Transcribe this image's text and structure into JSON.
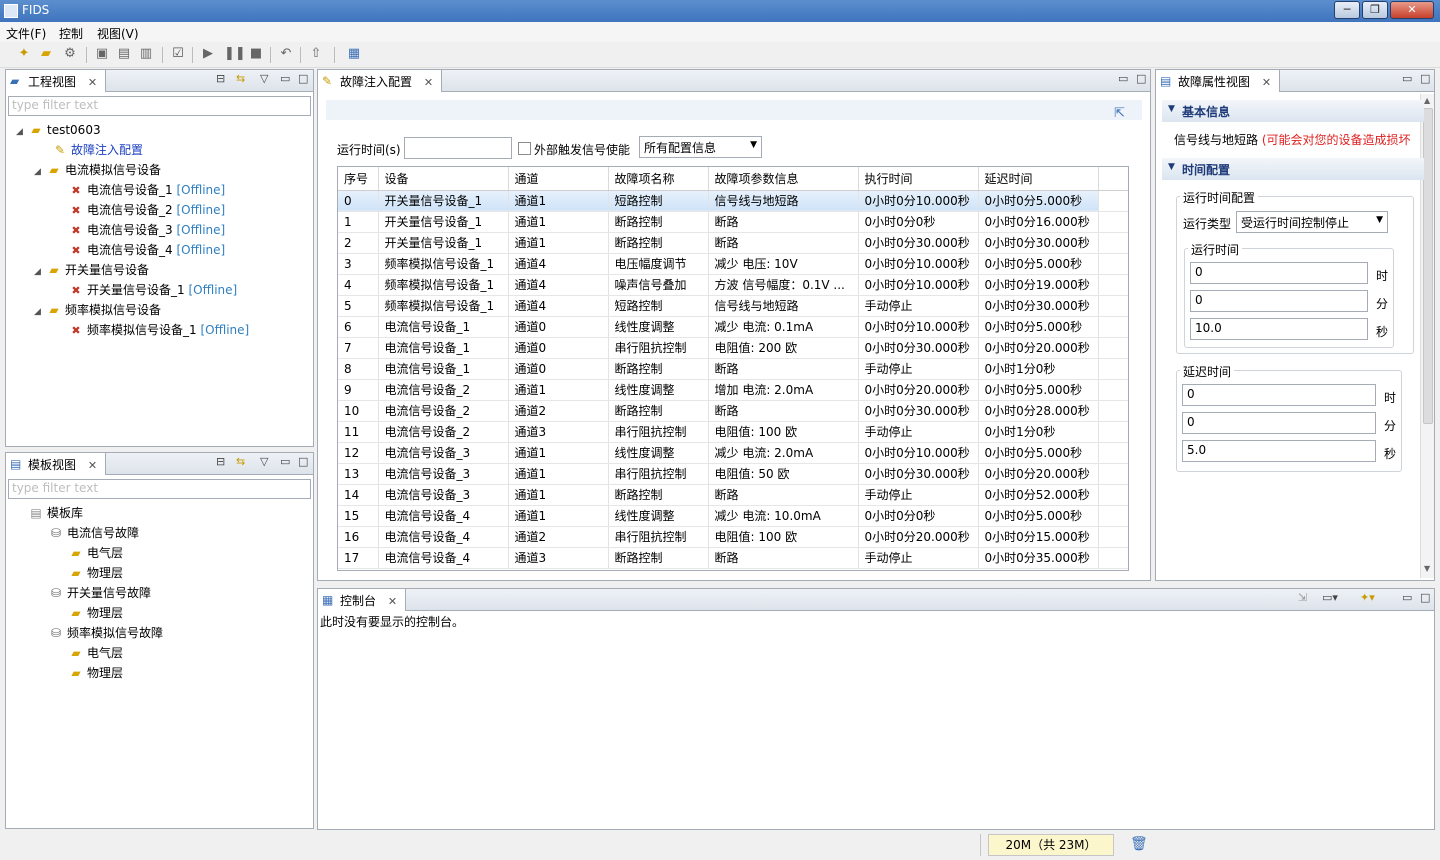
{
  "window": {
    "title": "FIDS",
    "controls": [
      "─",
      "❐",
      "✕"
    ]
  },
  "menu": {
    "items": [
      "文件(F)",
      "控制",
      "视图(V)"
    ]
  },
  "project_view": {
    "tab_label": "工程视图",
    "filter_placeholder": "type filter text",
    "root": "test0603",
    "fault_config": "故障注入配置",
    "groups": [
      {
        "label": "电流模拟信号设备",
        "devices": [
          {
            "name": "电流信号设备_1",
            "status": "[Offline]"
          },
          {
            "name": "电流信号设备_2",
            "status": "[Offline]"
          },
          {
            "name": "电流信号设备_3",
            "status": "[Offline]"
          },
          {
            "name": "电流信号设备_4",
            "status": "[Offline]"
          }
        ]
      },
      {
        "label": "开关量信号设备",
        "devices": [
          {
            "name": "开关量信号设备_1",
            "status": "[Offline]"
          }
        ]
      },
      {
        "label": "频率模拟信号设备",
        "devices": [
          {
            "name": "频率模拟信号设备_1",
            "status": "[Offline]"
          }
        ]
      }
    ]
  },
  "template_view": {
    "tab_label": "模板视图",
    "filter_placeholder": "type filter text",
    "root": "模板库",
    "groups": [
      {
        "label": "电流信号故障",
        "layers": [
          "电气层",
          "物理层"
        ]
      },
      {
        "label": "开关量信号故障",
        "layers": [
          "物理层"
        ]
      },
      {
        "label": "频率模拟信号故障",
        "layers": [
          "电气层",
          "物理层"
        ]
      }
    ]
  },
  "fault_config": {
    "tab_label": "故障注入配置",
    "run_time_label": "运行时间(s)",
    "run_time_value": "",
    "external_trigger_label": "外部触发信号使能",
    "external_trigger_checked": false,
    "filter_select": "所有配置信息",
    "columns": [
      "序号",
      "设备",
      "通道",
      "故障项名称",
      "故障项参数信息",
      "执行时间",
      "延迟时间"
    ],
    "rows": [
      [
        "0",
        "开关量信号设备_1",
        "通道1",
        "短路控制",
        "信号线与地短路",
        "0小时0分10.000秒",
        "0小时0分5.000秒"
      ],
      [
        "1",
        "开关量信号设备_1",
        "通道1",
        "断路控制",
        "断路",
        "0小时0分0秒",
        "0小时0分16.000秒"
      ],
      [
        "2",
        "开关量信号设备_1",
        "通道1",
        "断路控制",
        "断路",
        "0小时0分30.000秒",
        "0小时0分30.000秒"
      ],
      [
        "3",
        "频率模拟信号设备_1",
        "通道4",
        "电压幅度调节",
        "减少 电压: 10V",
        "0小时0分10.000秒",
        "0小时0分5.000秒"
      ],
      [
        "4",
        "频率模拟信号设备_1",
        "通道4",
        "噪声信号叠加",
        "方波 信号幅度：0.1V ...",
        "0小时0分10.000秒",
        "0小时0分19.000秒"
      ],
      [
        "5",
        "频率模拟信号设备_1",
        "通道4",
        "短路控制",
        "信号线与地短路",
        "手动停止",
        "0小时0分30.000秒"
      ],
      [
        "6",
        "电流信号设备_1",
        "通道0",
        "线性度调整",
        "减少 电流: 0.1mA",
        "0小时0分10.000秒",
        "0小时0分5.000秒"
      ],
      [
        "7",
        "电流信号设备_1",
        "通道0",
        "串行阻抗控制",
        "电阻值: 200 欧",
        "0小时0分30.000秒",
        "0小时0分20.000秒"
      ],
      [
        "8",
        "电流信号设备_1",
        "通道0",
        "断路控制",
        "断路",
        "手动停止",
        "0小时1分0秒"
      ],
      [
        "9",
        "电流信号设备_2",
        "通道1",
        "线性度调整",
        "增加 电流: 2.0mA",
        "0小时0分20.000秒",
        "0小时0分5.000秒"
      ],
      [
        "10",
        "电流信号设备_2",
        "通道2",
        "断路控制",
        "断路",
        "0小时0分30.000秒",
        "0小时0分28.000秒"
      ],
      [
        "11",
        "电流信号设备_2",
        "通道3",
        "串行阻抗控制",
        "电阻值: 100 欧",
        "手动停止",
        "0小时1分0秒"
      ],
      [
        "12",
        "电流信号设备_3",
        "通道1",
        "线性度调整",
        "减少 电流: 2.0mA",
        "0小时0分10.000秒",
        "0小时0分5.000秒"
      ],
      [
        "13",
        "电流信号设备_3",
        "通道1",
        "串行阻抗控制",
        "电阻值: 50 欧",
        "0小时0分30.000秒",
        "0小时0分20.000秒"
      ],
      [
        "14",
        "电流信号设备_3",
        "通道1",
        "断路控制",
        "断路",
        "手动停止",
        "0小时0分52.000秒"
      ],
      [
        "15",
        "电流信号设备_4",
        "通道1",
        "线性度调整",
        "减少 电流: 10.0mA",
        "0小时0分0秒",
        "0小时0分5.000秒"
      ],
      [
        "16",
        "电流信号设备_4",
        "通道2",
        "串行阻抗控制",
        "电阻值: 100 欧",
        "0小时0分20.000秒",
        "0小时0分15.000秒"
      ],
      [
        "17",
        "电流信号设备_4",
        "通道3",
        "断路控制",
        "断路",
        "手动停止",
        "0小时0分35.000秒"
      ]
    ]
  },
  "properties": {
    "tab_label": "故障属性视图",
    "basic_info_header": "基本信息",
    "fault_name": "信号线与地短路",
    "warning": "(可能会对您的设备造成损坏",
    "time_config_header": "时间配置",
    "run_config_group": "运行时间配置",
    "run_type_label": "运行类型",
    "run_type_value": "受运行时间控制停止",
    "run_time_group": "运行时间",
    "run_hours": "0",
    "run_minutes": "0",
    "run_seconds": "10.0",
    "delay_group": "延迟时间",
    "delay_hours": "0",
    "delay_minutes": "0",
    "delay_seconds": "5.0",
    "unit_h": "时",
    "unit_m": "分",
    "unit_s": "秒"
  },
  "console": {
    "tab_label": "控制台",
    "message": "此时没有要显示的控制台。"
  },
  "status": {
    "memory": "20M（共 23M）"
  },
  "colors": {
    "selection": "#cfe3f8",
    "offline": "#2f7fc1",
    "warning": "#e02020",
    "title_bar": "#3f74bd"
  }
}
